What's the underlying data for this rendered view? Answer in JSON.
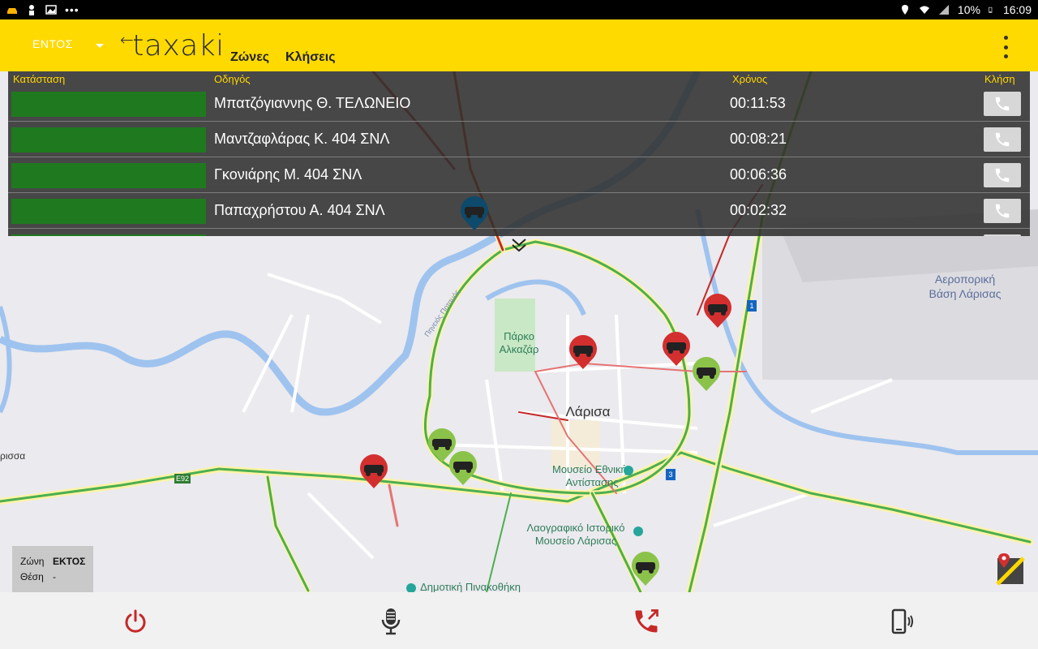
{
  "status_bar": {
    "battery": "10%",
    "clock": "16:09"
  },
  "app_bar": {
    "zone_label": "ΕΝΤΟΣ",
    "logo_text": "taxaki",
    "tabs": [
      {
        "label": "Ζώνες"
      },
      {
        "label": "Κλήσεις"
      }
    ]
  },
  "panel": {
    "headers": {
      "status": "Κατάσταση",
      "driver": "Οδηγός",
      "time": "Χρόνος",
      "call": "Κλήση"
    },
    "rows": [
      {
        "driver": "Μπατζόγιαννης Θ. ΤΕΛΩΝΕΙΟ",
        "time": "00:11:53",
        "status_color": "#1f7a1f"
      },
      {
        "driver": "Μαντζαφλάρας Κ. 404 ΣΝΛ",
        "time": "00:08:21",
        "status_color": "#1f7a1f"
      },
      {
        "driver": "Γκονιάρης Μ. 404 ΣΝΛ",
        "time": "00:06:36",
        "status_color": "#1f7a1f"
      },
      {
        "driver": "Παπαχρήστου Α. 404 ΣΝΛ",
        "time": "00:02:32",
        "status_color": "#1f7a1f"
      }
    ]
  },
  "map": {
    "labels": {
      "airport_1": "Αεροπορική",
      "airport_2": "Βάση Λάρισας",
      "park_1": "Πάρκο",
      "park_2": "Αλκαζάρ",
      "city": "Λάρισα",
      "museum1_1": "Μουσείο Εθνικής",
      "museum1_2": "Αντίστασης",
      "museum2_1": "Λαογραφικό Ιστορικό",
      "museum2_2": "Μουσείο Λάρισας",
      "gallery": "Δημοτική Πινακοθήκη",
      "left_edge": "ρισσα",
      "river": "Πηνειός Ποταμός",
      "route_e92": "E92",
      "route_1": "1",
      "route_3": "3"
    },
    "marker_colors": {
      "red": "#d32f2f",
      "green": "#8bc34a",
      "blue": "#0d4a6b"
    }
  },
  "info_box": {
    "zone_key": "Ζώνη",
    "zone_value": "ΕΚΤΟΣ",
    "position_key": "Θέση",
    "position_value": "-"
  },
  "bottom_bar": {
    "icons": [
      "power-icon",
      "microphone-icon",
      "outgoing-call-icon",
      "phone-vibrate-icon"
    ]
  }
}
